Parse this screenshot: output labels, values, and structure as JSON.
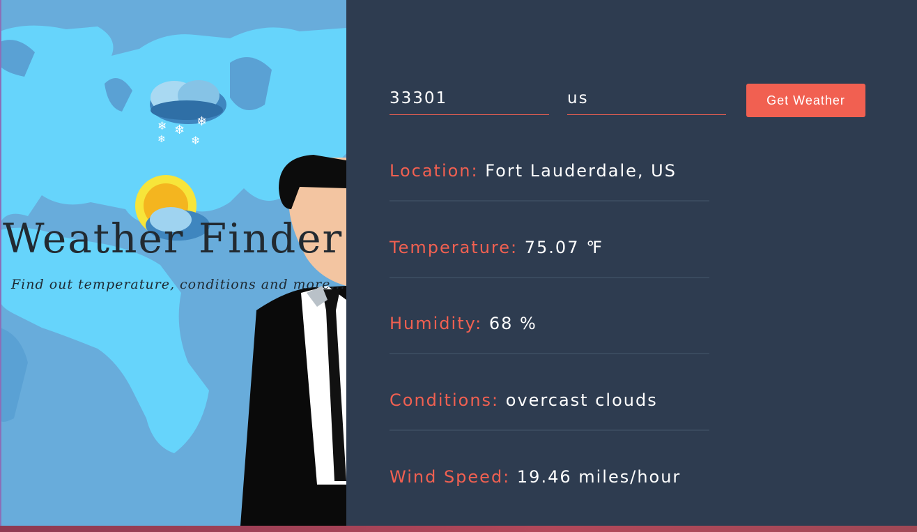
{
  "header": {
    "title": "Weather Finder",
    "subtitle": "Find out temperature, conditions and more..."
  },
  "form": {
    "city_value": "33301",
    "country_value": "us",
    "submit_label": "Get Weather"
  },
  "results": [
    {
      "label": "Location:",
      "value": "Fort Lauderdale, US"
    },
    {
      "label": "Temperature:",
      "value": "75.07 ℉"
    },
    {
      "label": "Humidity:",
      "value": "68 %"
    },
    {
      "label": "Conditions:",
      "value": "overcast clouds"
    },
    {
      "label": "Wind Speed:",
      "value": "19.46 miles/hour"
    }
  ],
  "colors": {
    "accent": "#f16051",
    "panel": "#2e3c50",
    "map_ocean": "#68acdb",
    "map_land": "#66d4fb"
  },
  "icons": [
    "snow-cloud-icon",
    "sun-cloud-icon"
  ]
}
